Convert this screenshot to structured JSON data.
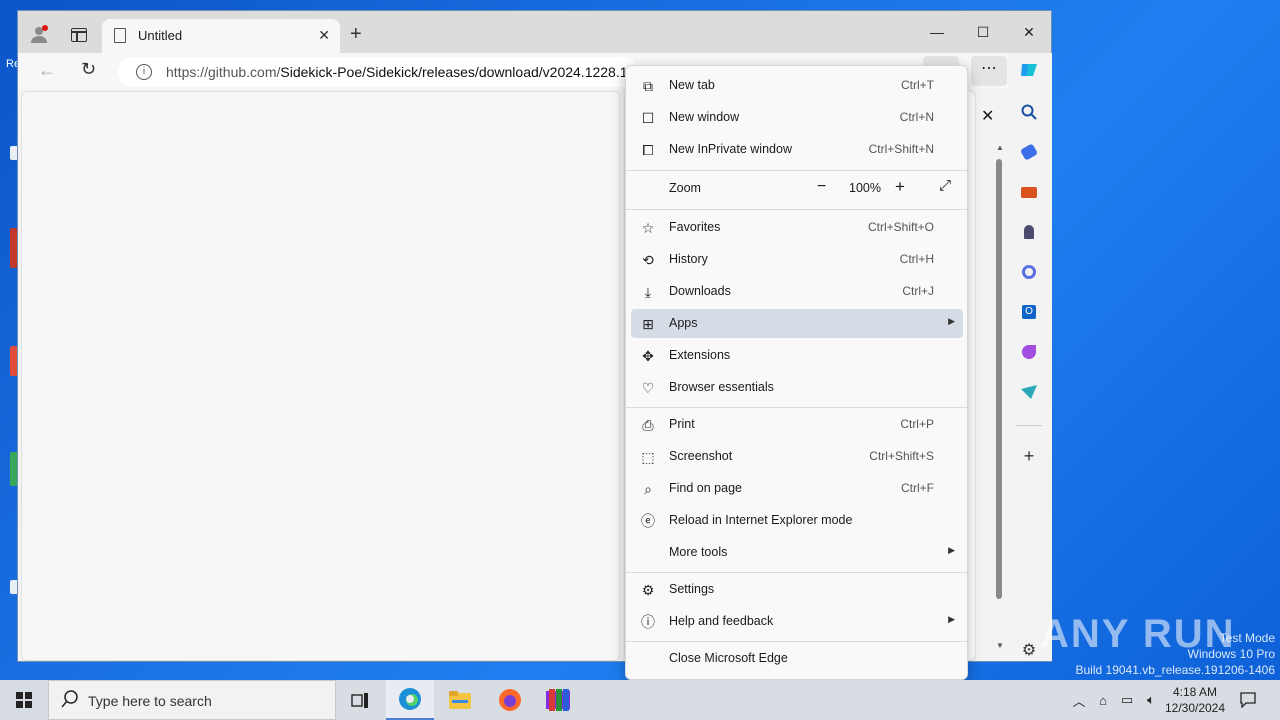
{
  "window": {
    "tab_title": "Untitled",
    "url_domain": "https://github.com/",
    "url_path": "Sidekick-Poe/Sidekick/releases/download/v2024.1228.1"
  },
  "menu": {
    "items": [
      {
        "label": "New tab",
        "shortcut": "Ctrl+T",
        "icon": "new-tab-icon"
      },
      {
        "label": "New window",
        "shortcut": "Ctrl+N",
        "icon": "new-window-icon"
      },
      {
        "label": "New InPrivate window",
        "shortcut": "Ctrl+Shift+N",
        "icon": "inprivate-icon"
      },
      {
        "label": "Favorites",
        "shortcut": "Ctrl+Shift+O",
        "icon": "favorites-icon"
      },
      {
        "label": "History",
        "shortcut": "Ctrl+H",
        "icon": "history-icon"
      },
      {
        "label": "Downloads",
        "shortcut": "Ctrl+J",
        "icon": "download-icon"
      },
      {
        "label": "Apps",
        "shortcut": "",
        "icon": "apps-icon",
        "submenu": true,
        "highlighted": true
      },
      {
        "label": "Extensions",
        "shortcut": "",
        "icon": "extensions-icon"
      },
      {
        "label": "Browser essentials",
        "shortcut": "",
        "icon": "heart-pulse-icon"
      },
      {
        "label": "Print",
        "shortcut": "Ctrl+P",
        "icon": "print-icon"
      },
      {
        "label": "Screenshot",
        "shortcut": "Ctrl+Shift+S",
        "icon": "screenshot-icon"
      },
      {
        "label": "Find on page",
        "shortcut": "Ctrl+F",
        "icon": "find-icon"
      },
      {
        "label": "Reload in Internet Explorer mode",
        "shortcut": "",
        "icon": "ie-icon"
      },
      {
        "label": "More tools",
        "shortcut": "",
        "icon": "",
        "submenu": true
      },
      {
        "label": "Settings",
        "shortcut": "",
        "icon": "gear-icon"
      },
      {
        "label": "Help and feedback",
        "shortcut": "",
        "icon": "help-icon",
        "submenu": true
      },
      {
        "label": "Close Microsoft Edge",
        "shortcut": "",
        "icon": ""
      }
    ],
    "zoom_label": "Zoom",
    "zoom_value": "100%"
  },
  "taskbar": {
    "search_placeholder": "Type here to search",
    "time": "4:18 AM",
    "date": "12/30/2024"
  },
  "watermark": {
    "line1": "Test Mode",
    "line2": "Windows 10 Pro",
    "line3": "Build 19041.vb_release.191206-1406",
    "brand": "ANY RUN"
  }
}
